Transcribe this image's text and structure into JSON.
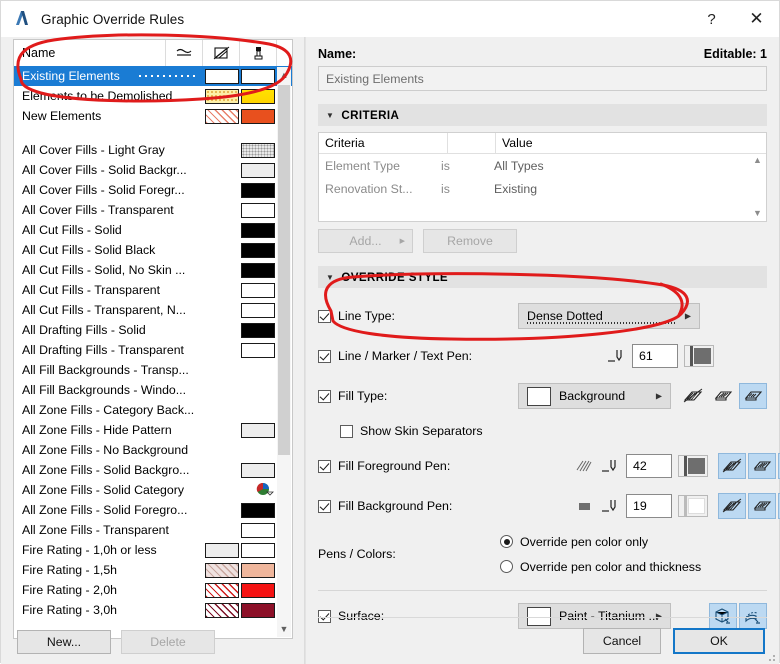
{
  "window": {
    "title": "Graphic Override Rules",
    "help_label": "?",
    "close_label": "✕",
    "app_icon": "archicad-logo-icon"
  },
  "left_panel": {
    "columns": {
      "name": "Name",
      "icon_line": "line-type-icon",
      "icon_fill": "fill-override-icon",
      "icon_surface": "surface-override-icon"
    },
    "rules": [
      {
        "name": "Existing Elements",
        "selected": true,
        "line": "dotted",
        "fill": "#ffffff",
        "surface": "#ffffff"
      },
      {
        "name": "Elements to be Demolished",
        "selected": false,
        "fill": "#fdf0a8",
        "fill_pattern": "dots",
        "surface": "#ffe500"
      },
      {
        "name": "New Elements",
        "selected": false,
        "fill": "#ffffff",
        "fill_pattern": "hatch-red",
        "surface": "#e8501e"
      }
    ],
    "presets": [
      {
        "name": "All Cover Fills - Light Gray",
        "fill": "#e8e8e8",
        "fill_pattern": "dots-gray"
      },
      {
        "name": "All Cover Fills - Solid Backgr...",
        "fill": "#ededed"
      },
      {
        "name": "All Cover Fills - Solid Foregr...",
        "fill": "#000000"
      },
      {
        "name": "All Cover Fills - Transparent",
        "fill": "#ffffff"
      },
      {
        "name": "All Cut Fills - Solid",
        "fill": "#000000"
      },
      {
        "name": "All Cut Fills - Solid Black",
        "fill": "#000000"
      },
      {
        "name": "All Cut Fills - Solid, No Skin ...",
        "fill": "#000000"
      },
      {
        "name": "All Cut Fills - Transparent",
        "fill": "#ffffff"
      },
      {
        "name": "All Cut Fills - Transparent, N...",
        "fill": "#ffffff"
      },
      {
        "name": "All Drafting Fills - Solid",
        "fill": "#000000"
      },
      {
        "name": "All Drafting Fills - Transparent",
        "fill": "#ffffff"
      },
      {
        "name": "All Fill Backgrounds - Transp...",
        "fill": null
      },
      {
        "name": "All Fill Backgrounds - Windo...",
        "fill": null
      },
      {
        "name": "All Zone Fills - Category Back...",
        "fill": null
      },
      {
        "name": "All Zone Fills - Hide Pattern",
        "fill": "#ededed"
      },
      {
        "name": "All Zone Fills - No Background",
        "fill": null
      },
      {
        "name": "All Zone Fills - Solid Backgro...",
        "fill": "#ededed"
      },
      {
        "name": "All Zone Fills - Solid Category",
        "fill": "category-color-icon"
      },
      {
        "name": "All Zone Fills - Solid Foregro...",
        "fill": "#000000"
      },
      {
        "name": "All Zone Fills - Transparent",
        "fill": "#ffffff"
      },
      {
        "name": "Fire Rating - 1,0h or less",
        "fill": "#ededed",
        "surface": "#ffffff"
      },
      {
        "name": "Fire Rating - 1,5h",
        "fill": "#efe2e0",
        "fill_pattern": "hatch-pink",
        "surface": "#efb69c"
      },
      {
        "name": "Fire Rating - 2,0h",
        "fill": "#ffffff",
        "fill_pattern": "hatch-red2",
        "surface": "#f51313"
      },
      {
        "name": "Fire Rating - 3,0h",
        "fill": "#ffffff",
        "fill_pattern": "hatch-darkred",
        "surface": "#8c1028"
      }
    ],
    "buttons": {
      "new": "New...",
      "delete": "Delete"
    }
  },
  "right_panel": {
    "name_label": "Name:",
    "editable_label": "Editable: 1",
    "name_value": "Existing Elements",
    "criteria_section": {
      "title": "CRITERIA",
      "headers": {
        "criteria": "Criteria",
        "op": "",
        "value": "Value"
      },
      "rows": [
        {
          "criteria": "Element Type",
          "op": "is",
          "value": "All Types"
        },
        {
          "criteria": "Renovation St...",
          "op": "is",
          "value": "Existing"
        }
      ],
      "add_button": "Add...",
      "remove_button": "Remove"
    },
    "override_section": {
      "title": "OVERRIDE STYLE",
      "line_type": {
        "label": "Line Type:",
        "checked": true,
        "value": "Dense Dotted"
      },
      "line_pen": {
        "label": "Line / Marker / Text Pen:",
        "checked": true,
        "value": "61",
        "color": "#6e6e6e"
      },
      "fill_type": {
        "label": "Fill Type:",
        "checked": true,
        "value": "Background",
        "swatch": "#ffffff"
      },
      "skin_separators": {
        "label": "Show Skin Separators",
        "checked": false
      },
      "fill_fg_pen": {
        "label": "Fill Foreground Pen:",
        "checked": true,
        "value": "42",
        "color": "#6e6e6e"
      },
      "fill_bg_pen": {
        "label": "Fill Background Pen:",
        "checked": true,
        "value": "19",
        "color": "#ffffff"
      },
      "pens_colors": {
        "label": "Pens / Colors:",
        "option_color_only": "Override pen color only",
        "option_color_thickness": "Override pen color and thickness",
        "selected": "color_only"
      },
      "surface": {
        "label": "Surface:",
        "checked": true,
        "value": "Paint - Titanium ...",
        "swatch": "#ffffff"
      },
      "fill_icons": [
        "cut-fill-icon",
        "cover-fill-icon",
        "drafting-fill-icon"
      ],
      "surface_icons": [
        "surface-3d-icon",
        "surface-shell-icon"
      ]
    }
  },
  "footer": {
    "cancel": "Cancel",
    "ok": "OK"
  },
  "annotations": {
    "color": "#e01b1b",
    "shapes": [
      "ellipse-around-rule-list",
      "ellipse-around-line-type"
    ]
  }
}
